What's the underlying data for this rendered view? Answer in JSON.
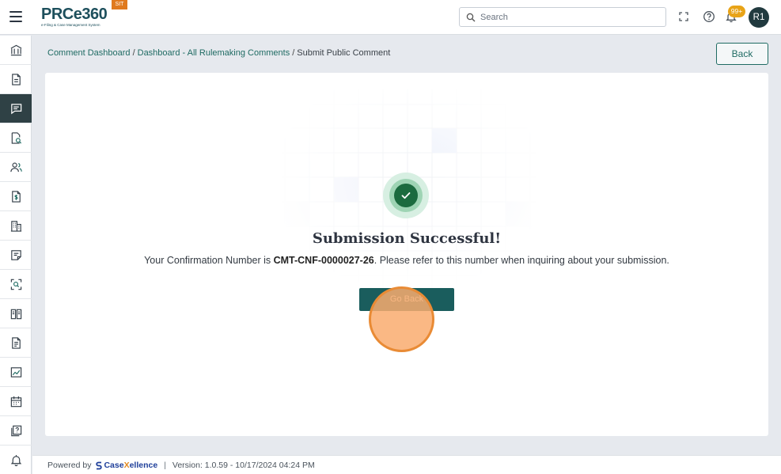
{
  "header": {
    "logo_text": "PRCe360",
    "logo_tagline": "e-Filing & Case Management System",
    "env_badge": "SIT",
    "search_placeholder": "Search",
    "notification_count": "99+",
    "avatar_initials": "R1"
  },
  "sidebar": {
    "items": [
      {
        "icon": "bank-icon"
      },
      {
        "icon": "document-icon"
      },
      {
        "icon": "comment-icon",
        "active": true
      },
      {
        "icon": "document-search-icon"
      },
      {
        "icon": "users-icon"
      },
      {
        "icon": "dollar-document-icon"
      },
      {
        "icon": "building-icon"
      },
      {
        "icon": "note-icon"
      },
      {
        "icon": "scan-search-icon"
      },
      {
        "icon": "book-icon"
      },
      {
        "icon": "file-text-icon"
      },
      {
        "icon": "chart-icon"
      },
      {
        "icon": "calendar-icon"
      },
      {
        "icon": "help-doc-icon"
      },
      {
        "icon": "bell-icon"
      }
    ]
  },
  "breadcrumb": {
    "item1": "Comment Dashboard",
    "item2": "Dashboard - All Rulemaking Comments",
    "current": "Submit Public Comment",
    "separator": "/"
  },
  "back_button": "Back",
  "success": {
    "title": "Submission Successful!",
    "prefix": "Your Confirmation Number is ",
    "confirmation_number": "CMT-CNF-0000027-26",
    "suffix": ". Please refer to this number when inquiring about your submission.",
    "go_back_label": "Go Back"
  },
  "footer": {
    "powered_by": "Powered by",
    "brand_pre": "Case",
    "brand_x": "X",
    "brand_post": "ellence",
    "separator": "|",
    "version_text": "Version: 1.0.59 - 10/17/2024 04:24 PM"
  },
  "colors": {
    "primary": "#1a5d5d",
    "success": "#1b6b3f",
    "badge": "#e8a317",
    "env_badge": "#e07a1f"
  }
}
